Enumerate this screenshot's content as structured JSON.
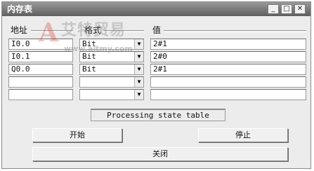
{
  "window": {
    "title": "内存表"
  },
  "title_buttons": {
    "minimize": "_",
    "maximize": "□",
    "close": "✕"
  },
  "columns": {
    "address": "地址",
    "format": "格式",
    "value": "值"
  },
  "rows": [
    {
      "address": "I0.0",
      "format": "Bit",
      "value": "2#1"
    },
    {
      "address": "I0.1",
      "format": "Bit",
      "value": "2#0"
    },
    {
      "address": "Q0.0",
      "format": "Bit",
      "value": "2#1"
    },
    {
      "address": "",
      "format": "",
      "value": ""
    },
    {
      "address": "",
      "format": "",
      "value": ""
    }
  ],
  "status": "Processing state table",
  "buttons": {
    "start": "开始",
    "stop": "停止",
    "close": "关闭"
  },
  "watermark": {
    "mark": "A",
    "brand": "艾特贸易",
    "url": "www.aitmy.com"
  },
  "icons": {
    "dropdown": "▼"
  }
}
